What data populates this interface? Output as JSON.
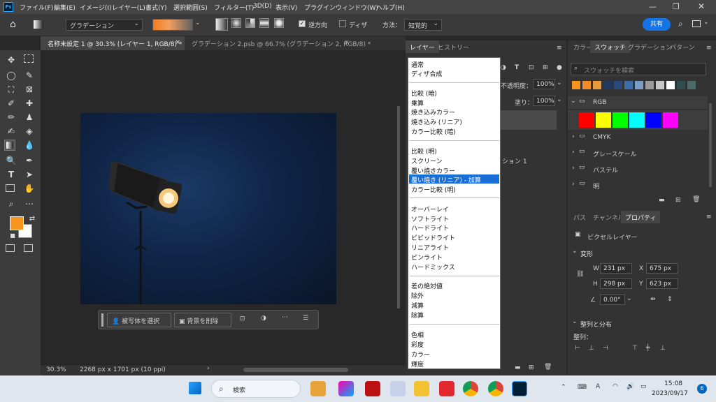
{
  "menubar": {
    "app_logo": "Ps",
    "items": [
      "ファイル(F)",
      "編集(E)",
      "イメージ(I)",
      "レイヤー(L)",
      "書式(Y)",
      "選択範囲(S)",
      "フィルター(T)",
      "3D(D)",
      "表示(V)",
      "プラグイン",
      "ウィンドウ(W)",
      "ヘルプ(H)"
    ]
  },
  "options": {
    "gradient_label": "グラデーション",
    "reverse_label": "逆方向",
    "dither_label": "ディザ",
    "method_label": "方法：",
    "method_value": "知覚的",
    "share_label": "共有"
  },
  "tabs": [
    {
      "label": "名称未設定 1 @ 30.3% (レイヤー 1, RGB/8) *"
    },
    {
      "label": "グラデーション 2.psb @ 66.7% (グラデーション 2, RGB/8) *"
    }
  ],
  "taskbar_ctx": {
    "select_subject": "被写体を選択",
    "remove_bg": "背景を削除"
  },
  "status": {
    "zoom": "30.3%",
    "doc_size": "2268 px x 1701 px (10 ppi)"
  },
  "layers_panel": {
    "tab_layers": "レイヤー",
    "tab_history": "ヒストリー",
    "opacity_label": "不透明度：",
    "opacity_value": "100%",
    "fill_label": "塗り：",
    "fill_value": "100%",
    "partial_layer": "ション 1"
  },
  "blend_modes": {
    "group1": [
      "通常",
      "ディザ合成"
    ],
    "group2": [
      "比較 (暗)",
      "乗算",
      "焼き込みカラー",
      "焼き込み (リニア)",
      "カラー比較 (暗)"
    ],
    "group3": [
      "比較 (明)",
      "スクリーン",
      "覆い焼きカラー",
      "覆い焼き (リニア) - 加算",
      "カラー比較 (明)"
    ],
    "group4": [
      "オーバーレイ",
      "ソフトライト",
      "ハードライト",
      "ビビッドライト",
      "リニアライト",
      "ピンライト",
      "ハードミックス"
    ],
    "group5": [
      "差の絶対値",
      "除外",
      "減算",
      "除算"
    ],
    "group6": [
      "色相",
      "彩度",
      "カラー",
      "輝度"
    ],
    "selected": "覆い焼き (リニア) - 加算"
  },
  "swatches": {
    "tabs": [
      "カラー",
      "スウォッチ",
      "グラデーション",
      "パターン"
    ],
    "search_placeholder": "スウォッチを検索",
    "recent": [
      "#f7941d",
      "#f28c28",
      "#e89a3c",
      "#1f3a5f",
      "#2a4a7a",
      "#3c6ea8",
      "#7a9ac8",
      "#9a9a9a",
      "#c8c8c8",
      "#ffffff",
      "#2f4f4f",
      "#4a6a6a"
    ],
    "groups": [
      "RGB",
      "CMYK",
      "グレースケール",
      "パステル",
      "明"
    ],
    "rgb_colors": [
      "#ff0000",
      "#ffff00",
      "#00ff00",
      "#00ffff",
      "#0000ff",
      "#ff00ff"
    ]
  },
  "properties": {
    "tabs": [
      "パス",
      "チャンネル",
      "プロパティ"
    ],
    "layer_type": "ピクセルレイヤー",
    "transform_label": "変形",
    "w_label": "W",
    "w": "231 px",
    "x_label": "X",
    "x": "675 px",
    "h_label": "H",
    "h": "298 px",
    "y_label": "Y",
    "y": "623 px",
    "angle": "0.00°",
    "align_label": "整列と分布",
    "align_sub": "整列："
  },
  "system": {
    "search": "検索",
    "time": "15:08",
    "date": "2023/09/17",
    "notif": "6"
  },
  "colors": {
    "fg": "#f7941d",
    "bg": "#ffffff",
    "accent": "#1473e6"
  }
}
